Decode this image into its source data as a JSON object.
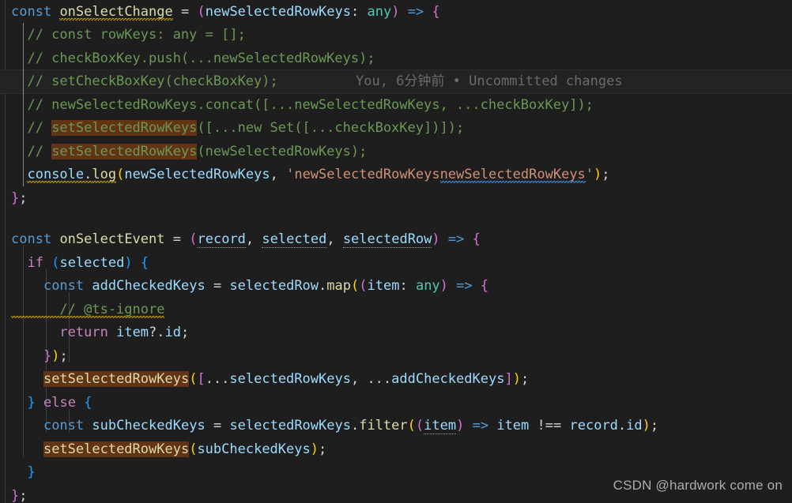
{
  "editor": {
    "language": "typescript",
    "theme": "Dark+ (default dark)",
    "background": "#1e1e1e",
    "highlight_color": "#623315",
    "blame": {
      "author": "You",
      "time": "6分钟前",
      "separator": "•",
      "status": "Uncommitted changes",
      "full_text": "You, 6分钟前 • Uncommitted changes"
    },
    "watermark": "CSDN @hardwork come on",
    "code_lines": [
      "const onSelectChange = (newSelectedRowKeys: any) => {",
      "  // const rowKeys: any = [];",
      "  // checkBoxKey.push(...newSelectedRowKeys);",
      "  // setCheckBoxKey(checkBoxKey);",
      "  // newSelectedRowKeys.concat([...newSelectedRowKeys, ...checkBoxKey]);",
      "  // setSelectedRowKeys([...new Set([...checkBoxKey])]);",
      "  // setSelectedRowKeys(newSelectedRowKeys);",
      "  console.log(newSelectedRowKeys, 'newSelectedRowKeysnewSelectedRowKeys');",
      "};",
      "",
      "const onSelectEvent = (record, selected, selectedRow) => {",
      "  if (selected) {",
      "    const addCheckedKeys = selectedRow.map((item: any) => {",
      "      // @ts-ignore",
      "      return item?.id;",
      "    });",
      "    setSelectedRowKeys([...selectedRowKeys, ...addCheckedKeys]);",
      "  } else {",
      "    const subCheckedKeys = selectedRowKeys.filter((item) => item !== record.id);",
      "    setSelectedRowKeys(subCheckedKeys);",
      "  }",
      "};"
    ],
    "search_match_term": "setSelectedRowKeys",
    "search_match_count": 4
  }
}
